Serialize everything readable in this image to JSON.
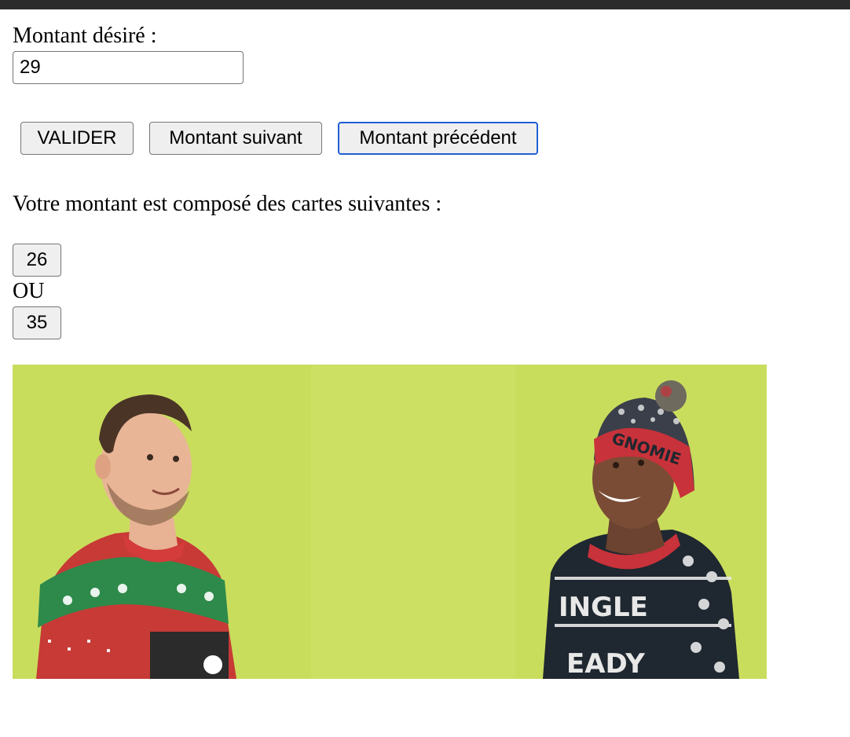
{
  "form": {
    "label": "Montant désiré :",
    "amount_value": "29",
    "buttons": {
      "validate": "VALIDER",
      "next": "Montant suivant",
      "previous": "Montant précédent"
    }
  },
  "result": {
    "intro": "Votre montant est composé des cartes suivantes :",
    "card_options": [
      "26",
      "35"
    ],
    "separator": "OU"
  },
  "image": {
    "description_icon": "holiday-sweaters-photo",
    "beanie_text": "GNOMIE",
    "sweater_text_line1": "INGLE",
    "sweater_text_line2": "EADY"
  },
  "colors": {
    "photo_background": "#c9dd5d",
    "focus_ring": "#1f5fd6",
    "button_bg": "#efefef"
  }
}
